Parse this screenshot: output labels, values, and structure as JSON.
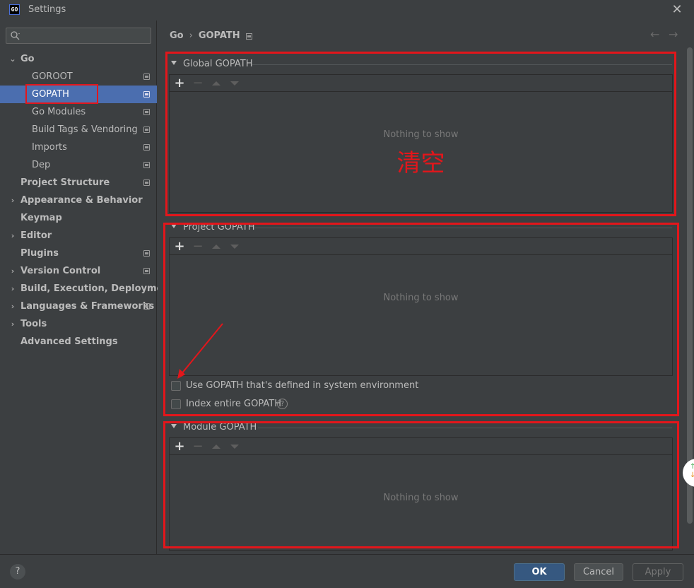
{
  "window": {
    "title": "Settings",
    "logo_text": "GO"
  },
  "search": {
    "placeholder": "",
    "value": ""
  },
  "sidebar": {
    "items": [
      {
        "label": "Go",
        "expanded": true
      },
      {
        "label": "GOROOT"
      },
      {
        "label": "GOPATH",
        "selected": true
      },
      {
        "label": "Go Modules"
      },
      {
        "label": "Build Tags & Vendoring"
      },
      {
        "label": "Imports"
      },
      {
        "label": "Dep"
      },
      {
        "label": "Project Structure"
      },
      {
        "label": "Appearance & Behavior"
      },
      {
        "label": "Keymap"
      },
      {
        "label": "Editor"
      },
      {
        "label": "Plugins"
      },
      {
        "label": "Version Control"
      },
      {
        "label": "Build, Execution, Deployment"
      },
      {
        "label": "Languages & Frameworks"
      },
      {
        "label": "Tools"
      },
      {
        "label": "Advanced Settings"
      }
    ]
  },
  "breadcrumb": {
    "parent": "Go",
    "separator": "›",
    "current": "GOPATH"
  },
  "sections": {
    "global": {
      "title": "Global GOPATH",
      "empty_text": "Nothing to show",
      "annotation": "清空"
    },
    "project": {
      "title": "Project GOPATH",
      "empty_text": "Nothing to show",
      "use_system_label": "Use GOPATH that's defined in system environment",
      "index_entire_label": "Index entire GOPATH"
    },
    "module": {
      "title": "Module GOPATH",
      "empty_text": "Nothing to show"
    }
  },
  "toolbar": {
    "add": "+",
    "remove": "−"
  },
  "buttons": {
    "ok": "OK",
    "cancel": "Cancel",
    "apply": "Apply",
    "help": "?"
  },
  "colors": {
    "annotation_red": "#e3161b",
    "selection_blue": "#4b6eaf",
    "ok_blue": "#365880"
  }
}
